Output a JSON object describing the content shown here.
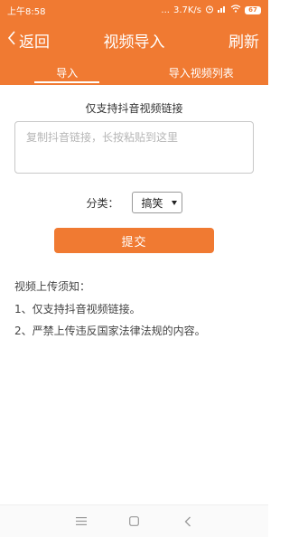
{
  "status_bar": {
    "time": "上午8:58",
    "dots": "...",
    "speed": "3.7K/s",
    "battery": "67"
  },
  "nav": {
    "back_label": "返回",
    "title": "视频导入",
    "refresh_label": "刷新"
  },
  "tabs": [
    {
      "label": "导入",
      "active": true
    },
    {
      "label": "导入视频列表",
      "active": false
    }
  ],
  "main": {
    "hint_title": "仅支持抖音视频链接",
    "link_placeholder": "复制抖音链接，长按粘贴到这里",
    "link_value": "",
    "category_label": "分类：",
    "category_selected": "搞笑",
    "submit_label": "提交",
    "notice_title": "视频上传须知：",
    "notice_items": [
      "1、仅支持抖音视频链接。",
      "2、严禁上传违反国家法律法规的内容。"
    ]
  },
  "colors": {
    "accent": "#f07a32"
  },
  "icons": [
    "back-chevron-icon",
    "alarm-icon",
    "signal-icon",
    "wifi-icon",
    "battery-icon",
    "menu-icon",
    "home-icon",
    "back-nav-icon"
  ]
}
